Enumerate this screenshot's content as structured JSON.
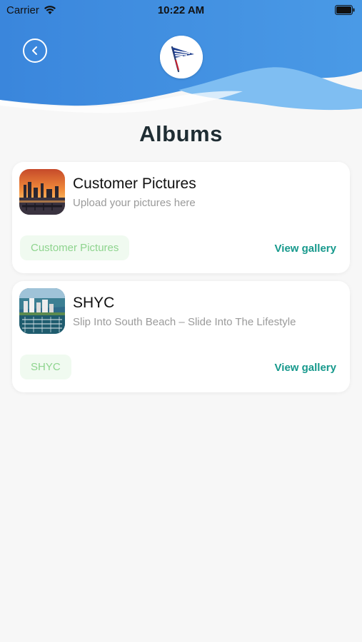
{
  "status_bar": {
    "carrier": "Carrier",
    "time": "10:22 AM"
  },
  "header": {
    "back_icon": "chevron-left-icon",
    "logo_icon": "burgee-flag-icon",
    "colors": {
      "wave_dark": "#3f8de0",
      "wave_light": "#7fbef2"
    }
  },
  "page": {
    "title": "Albums"
  },
  "albums": [
    {
      "title": "Customer Pictures",
      "subtitle": "Upload your pictures here",
      "tag": "Customer Pictures",
      "link": "View gallery"
    },
    {
      "title": "SHYC",
      "subtitle": "Slip Into South Beach – Slide Into The Lifestyle",
      "tag": "SHYC",
      "link": "View gallery"
    }
  ],
  "colors": {
    "accent": "#16998c",
    "tag_bg": "#f0faf0",
    "tag_text": "#8ed48e",
    "title": "#1f2d33"
  }
}
